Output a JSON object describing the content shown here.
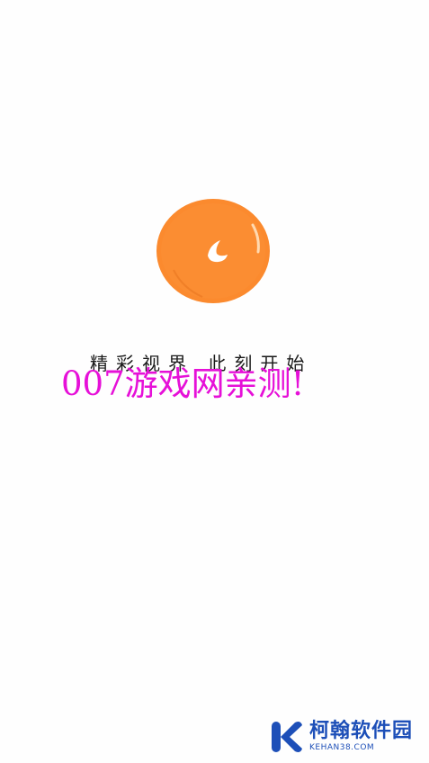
{
  "splash": {
    "logo_icon": "orange-fruit-icon",
    "tagline": "精彩视界 此刻开始"
  },
  "watermarks": {
    "overlay_text": "007游戏网亲测!",
    "overlay_color": "#e610d8",
    "brand_icon": "k-logo-icon",
    "brand_name": "柯翰软件园",
    "brand_url": "KEHAN38.COM",
    "brand_color": "#1d4fb8"
  },
  "colors": {
    "logo_orange": "#fb8a2e",
    "background": "#fefefe"
  }
}
